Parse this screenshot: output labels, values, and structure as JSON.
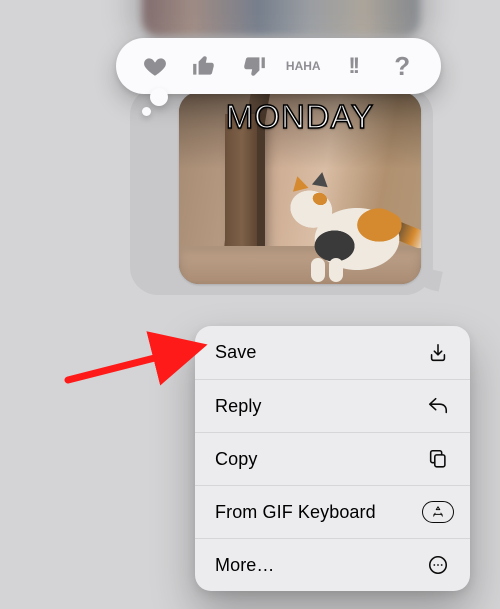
{
  "background": {
    "previous_image_alt": "blurred-prior-attachment"
  },
  "gif": {
    "caption": "MONDAY",
    "subject": "calico-cat",
    "setting": "hallway-door"
  },
  "tapbacks": {
    "icons": {
      "heart": "heart-icon",
      "thumbs_up": "thumbs-up-icon",
      "thumbs_down": "thumbs-down-icon",
      "haha_top": "HA",
      "haha_bottom": "HA",
      "emphasize": "!!",
      "question": "?"
    }
  },
  "menu": {
    "save": "Save",
    "reply": "Reply",
    "copy": "Copy",
    "from_gif_keyboard": "From GIF Keyboard",
    "more": "More…"
  },
  "annotation": {
    "arrow_color": "#ff1a1a",
    "target": "menu.save"
  }
}
